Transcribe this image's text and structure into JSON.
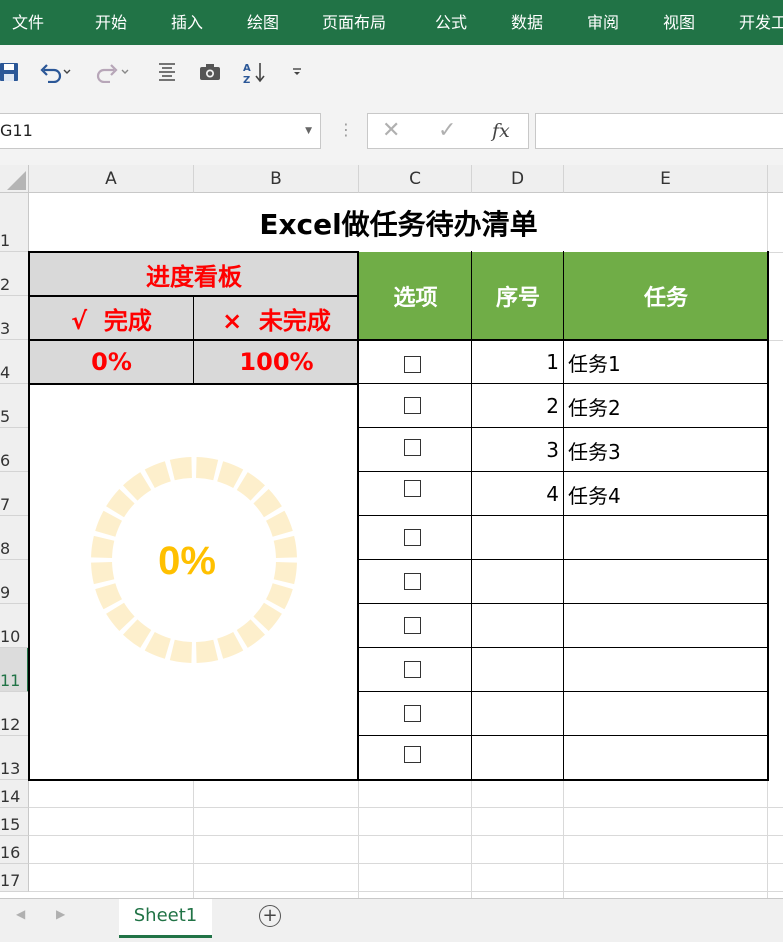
{
  "ribbon": {
    "tabs": [
      "文件",
      "开始",
      "插入",
      "绘图",
      "页面布局",
      "公式",
      "数据",
      "审阅",
      "视图",
      "开发工"
    ]
  },
  "quick_access": {
    "icons": [
      "save-icon",
      "undo-icon",
      "redo-icon",
      "align-icon",
      "camera-icon",
      "sort-icon",
      "customize-icon"
    ]
  },
  "formula_bar": {
    "name_box": "G11",
    "cancel_glyph": "✕",
    "enter_glyph": "✓",
    "fx_label": "fx",
    "formula": ""
  },
  "columns": [
    "A",
    "B",
    "C",
    "D",
    "E"
  ],
  "rows": [
    "1",
    "2",
    "3",
    "4",
    "5",
    "6",
    "7",
    "8",
    "9",
    "10",
    "11",
    "12",
    "13",
    "14",
    "15",
    "16",
    "17"
  ],
  "active_row": "11",
  "sheet": {
    "title": "Excel做任务待办清单",
    "board_title": "进度看板",
    "done_label": "√  完成",
    "undone_label": "×  未完成",
    "done_pct": "0%",
    "undone_pct": "100%",
    "table_headers": [
      "选项",
      "序号",
      "任务"
    ],
    "tasks": [
      {
        "no": "1",
        "name": "任务1"
      },
      {
        "no": "2",
        "name": "任务2"
      },
      {
        "no": "3",
        "name": "任务3"
      },
      {
        "no": "4",
        "name": "任务4"
      },
      {
        "no": "",
        "name": ""
      },
      {
        "no": "",
        "name": ""
      },
      {
        "no": "",
        "name": ""
      },
      {
        "no": "",
        "name": ""
      },
      {
        "no": "",
        "name": ""
      },
      {
        "no": "",
        "name": ""
      }
    ],
    "ring": {
      "label": "0%",
      "progress": 0,
      "segments": 24,
      "ring_color": "#fdefcc",
      "label_color": "#ffc000"
    }
  },
  "colors": {
    "ribbon": "#217346",
    "header_green": "#70ad47",
    "accent_red": "#ff0000"
  },
  "tabs_bottom": {
    "sheet_name": "Sheet1",
    "add_glyph": "+"
  }
}
